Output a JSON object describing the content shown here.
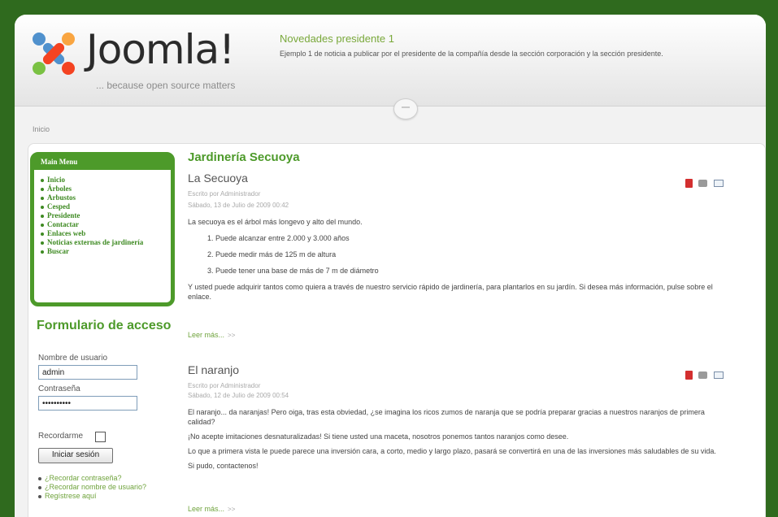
{
  "header": {
    "logo_text": "Joomla!",
    "logo_tagline": "... because open source matters",
    "news_title": "Novedades presidente 1",
    "news_text": "Ejemplo 1 de noticia a publicar por el presidente de la compañía desde la sección corporación y la sección presidente."
  },
  "breadcrumb": "Inicio",
  "main_menu": {
    "title": "Main Menu",
    "items": [
      "Inicio",
      "Árboles",
      "Arbustos",
      "Cesped",
      "Presidente",
      "Contactar",
      "Enlaces web",
      "Noticias externas de jardinería",
      "Buscar"
    ]
  },
  "login": {
    "title": "Formulario de acceso",
    "username_label": "Nombre de usuario",
    "username_value": "admin",
    "password_label": "Contraseña",
    "password_value": "••••••••••",
    "remember_label": "Recordarme",
    "submit_label": "Iniciar sesión",
    "links": [
      "¿Recordar contraseña?",
      "¿Recordar nombre de usuario?",
      "Regístrese aquí"
    ]
  },
  "category_title": "Jardinería Secuoya",
  "articles": [
    {
      "title": "La Secuoya",
      "author": "Escrito por Administrador",
      "date": "Sábado, 13 de Julio de 2009 00:42",
      "intro": "La secuoya es el árbol más longevo y alto del mundo.",
      "list": [
        "Puede alcanzar entre 2.000 y 3.000 años",
        "Puede medir más de 125 m de altura",
        "Puede tener una base de más de 7 m de diámetro"
      ],
      "body": "Y usted puede adquirir tantos como quiera a través de nuestro servicio rápido de jardinería, para plantarlos en su jardín. Si desea más información, pulse sobre el enlace.",
      "readmore": "Leer más...",
      "readmore_arrow": ">>"
    },
    {
      "title": "El naranjo",
      "author": "Escrito por Administrador",
      "date": "Sábado, 12 de Julio de 2009 00:54",
      "paragraphs": [
        "El naranjo... da naranjas! Pero oiga, tras esta obviedad, ¿se imagina los ricos zumos de naranja que se podría preparar gracias a nuestros naranjos de primera calidad?",
        "¡No acepte imitaciones desnaturalizadas! Si tiene usted una maceta, nosotros ponemos tantos naranjos como desee.",
        "Lo que a primera vista le puede parece una inversión cara, a corto, medio y largo plazo, pasará se convertirá en una de las inversiones más saludables de su vida.",
        "Si pudo, contactenos!"
      ],
      "readmore": "Leer más...",
      "readmore_arrow": ">>"
    }
  ],
  "icons": [
    "pdf-icon",
    "print-icon",
    "email-icon"
  ]
}
